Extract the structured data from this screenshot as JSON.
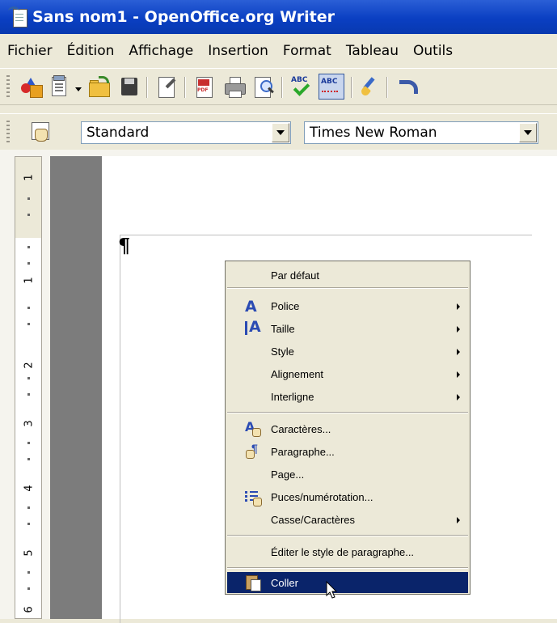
{
  "window": {
    "title": "Sans nom1 - OpenOffice.org Writer",
    "app_icon": "writer-doc-icon"
  },
  "menubar": {
    "items": [
      "Fichier",
      "Édition",
      "Affichage",
      "Insertion",
      "Format",
      "Tableau",
      "Outils"
    ]
  },
  "toolbar_standard": {
    "icons": [
      "new-document-icon",
      "templates-icon",
      "open-icon",
      "save-icon",
      "edit-file-icon",
      "export-pdf-icon",
      "print-icon",
      "page-preview-icon",
      "spellcheck-icon",
      "autospellcheck-icon",
      "format-paintbrush-icon",
      "undo-icon"
    ],
    "spellcheck_text": "ABC",
    "pdf_text": "PDF"
  },
  "toolbar_formatting": {
    "paragraph_style": "Standard",
    "font_name": "Times New Roman"
  },
  "ruler": {
    "numbers": [
      "1",
      "1",
      "2",
      "3",
      "4",
      "5",
      "6"
    ]
  },
  "document": {
    "pilcrow": "¶"
  },
  "context_menu": {
    "items": [
      {
        "label": "Par défaut",
        "submenu": false
      },
      {
        "label": "Police",
        "submenu": true,
        "icon": "font-icon"
      },
      {
        "label": "Taille",
        "submenu": true,
        "icon": "font-size-icon"
      },
      {
        "label": "Style",
        "submenu": true
      },
      {
        "label": "Alignement",
        "submenu": true
      },
      {
        "label": "Interligne",
        "submenu": true
      },
      {
        "label": "Caractères...",
        "submenu": false,
        "icon": "character-icon"
      },
      {
        "label": "Paragraphe...",
        "submenu": false,
        "icon": "paragraph-icon"
      },
      {
        "label": "Page...",
        "submenu": false
      },
      {
        "label": "Puces/numérotation...",
        "submenu": false,
        "icon": "bullets-icon"
      },
      {
        "label": "Casse/Caractères",
        "submenu": true
      },
      {
        "label": "Éditer le style de paragraphe...",
        "submenu": false
      },
      {
        "label": "Coller",
        "submenu": false,
        "icon": "paste-icon",
        "highlighted": true
      }
    ]
  },
  "colors": {
    "titlebar": "#0a3fc2",
    "highlight": "#0a246a",
    "face": "#ece9d8"
  }
}
